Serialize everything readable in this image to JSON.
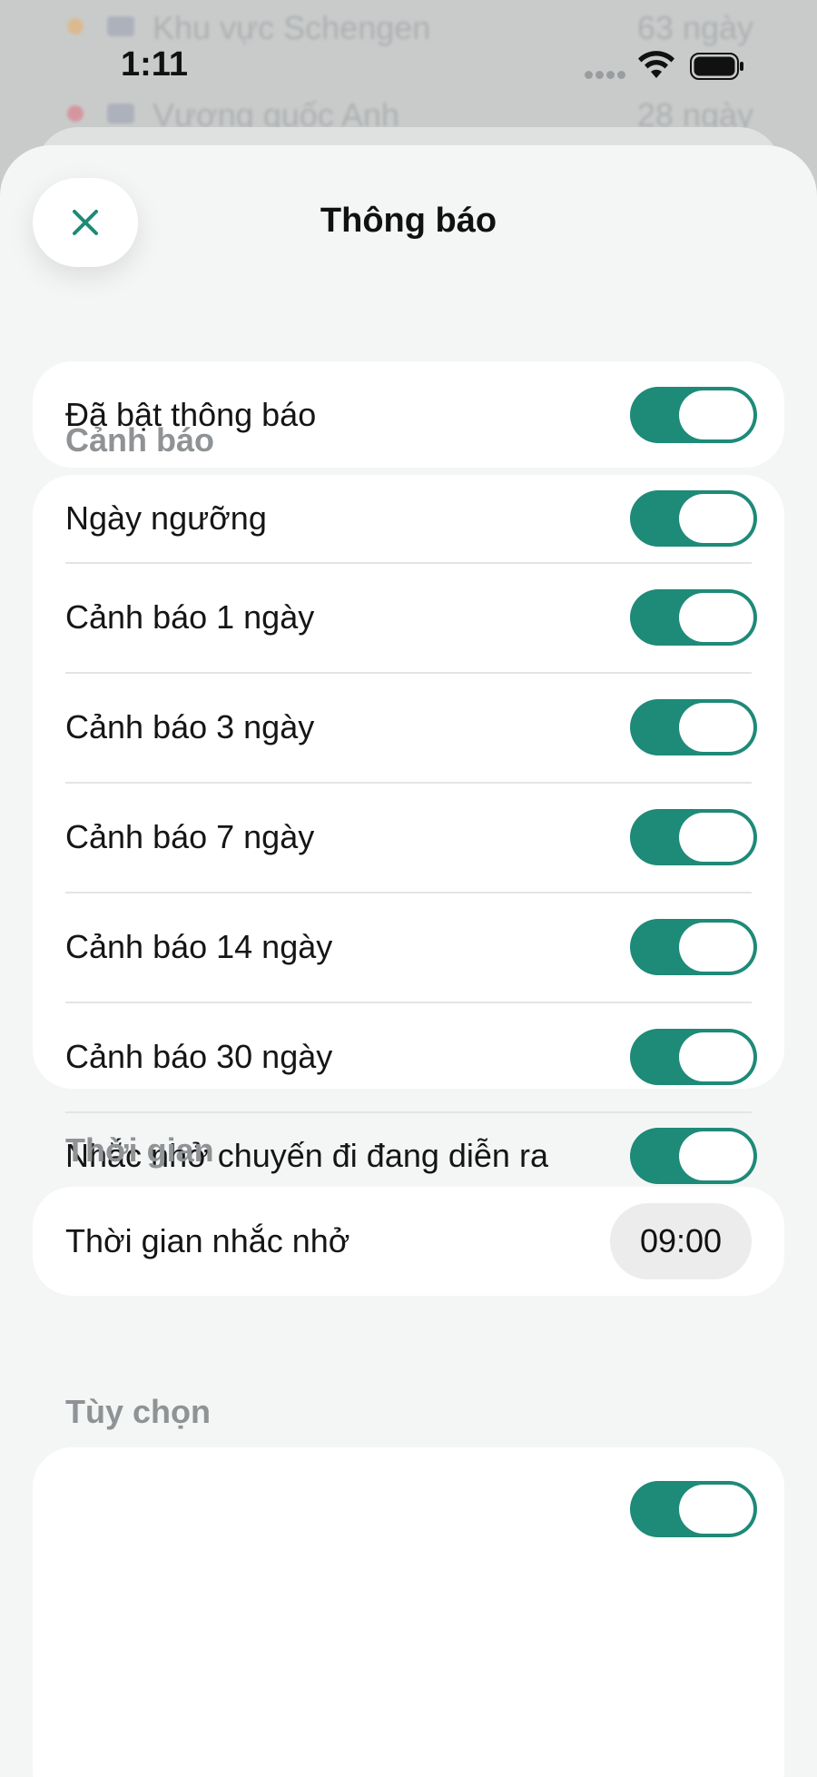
{
  "background_list": [
    {
      "name": "Khu vực Schengen",
      "days": "63 ngày",
      "dot_color": "#f2a64a"
    },
    {
      "name": "Vương quốc Anh",
      "days": "28 ngày",
      "dot_color": "#e5566a"
    }
  ],
  "status_bar": {
    "time": "1:11"
  },
  "sheet": {
    "title": "Thông báo",
    "close_icon": "close-x-icon"
  },
  "master": {
    "label": "Đã bật thông báo",
    "enabled": true
  },
  "alerts": {
    "section_title": "Cảnh báo",
    "items": [
      {
        "label": "Ngày ngưỡng",
        "enabled": true
      },
      {
        "label": "Cảnh báo 1 ngày",
        "enabled": true
      },
      {
        "label": "Cảnh báo 3 ngày",
        "enabled": true
      },
      {
        "label": "Cảnh báo 7 ngày",
        "enabled": true
      },
      {
        "label": "Cảnh báo 14 ngày",
        "enabled": true
      },
      {
        "label": "Cảnh báo 30 ngày",
        "enabled": true
      },
      {
        "label": "Nhắc nhở chuyến đi đang diễn ra",
        "enabled": true
      }
    ]
  },
  "time": {
    "section_title": "Thời gian",
    "reminder_label": "Thời gian nhắc nhở",
    "reminder_value": "09:00"
  },
  "options": {
    "section_title": "Tùy chọn"
  },
  "colors": {
    "accent": "#1e8a78",
    "sheet_bg": "#f4f6f6",
    "card_bg": "#ffffff",
    "section_text": "#8f9395"
  }
}
